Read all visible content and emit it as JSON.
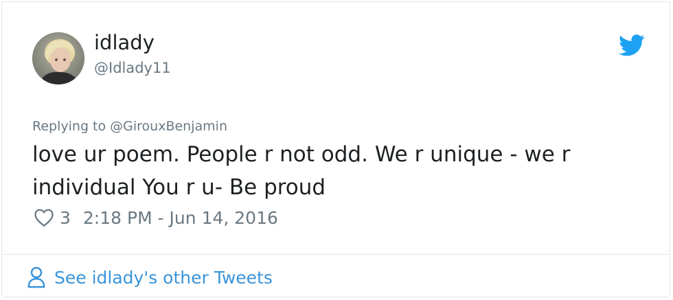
{
  "user": {
    "display_name": "idlady",
    "handle": "@Idlady11"
  },
  "tweet": {
    "replying_to": "Replying to @GirouxBenjamin",
    "text": "love ur poem. People r not odd. We r unique - we r individual You r u- Be proud",
    "likes": "3",
    "timestamp": "2:18 PM - Jun 14, 2016"
  },
  "footer": {
    "link_label": "See idlady's other Tweets"
  },
  "colors": {
    "brand_blue": "#1da1f2",
    "link_blue": "#3b94d9",
    "text_dark": "#1c2022",
    "text_muted": "#697882",
    "border": "#e1e8ed"
  },
  "icons": [
    "twitter-bird-icon",
    "heart-icon",
    "person-icon"
  ]
}
